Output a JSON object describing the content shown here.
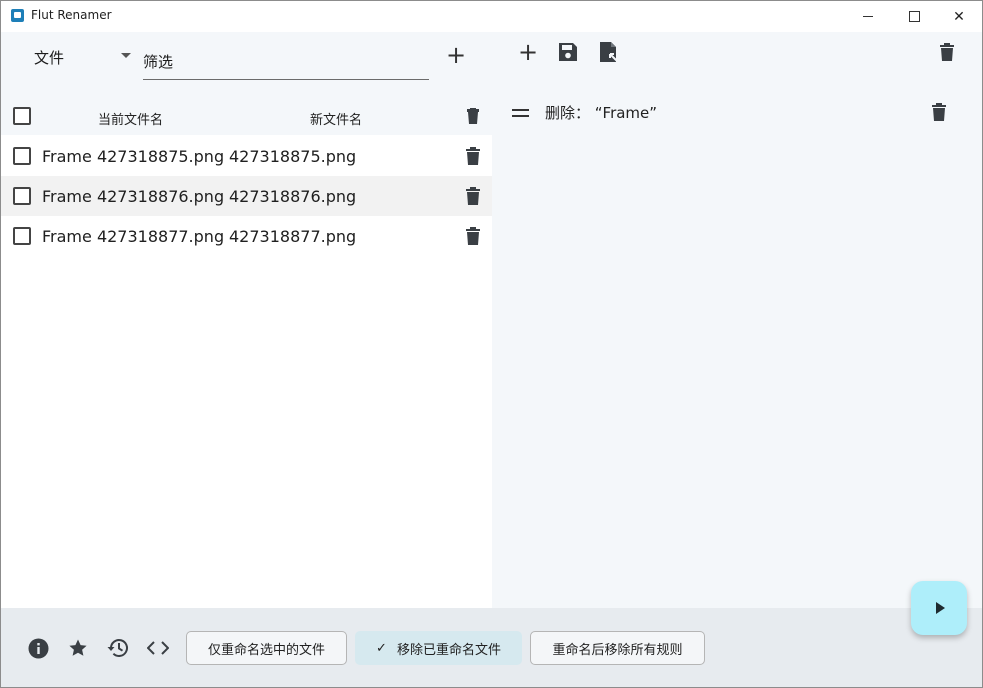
{
  "window": {
    "title": "Flut Renamer",
    "close_glyph": "✕"
  },
  "file_panel": {
    "type_select": {
      "value": "文件"
    },
    "filter": {
      "placeholder": "筛选",
      "value": ""
    },
    "add_label": "+",
    "columns": {
      "current": "当前文件名",
      "new": "新文件名"
    },
    "rows": [
      {
        "current": "Frame 427318875.png",
        "new": "427318875.png"
      },
      {
        "current": "Frame 427318876.png",
        "new": "427318876.png"
      },
      {
        "current": "Frame 427318877.png",
        "new": "427318877.png"
      }
    ]
  },
  "rule_panel": {
    "add_label": "+",
    "rules": [
      {
        "text": "删除：  “Frame”"
      }
    ]
  },
  "bottom_bar": {
    "buttons": {
      "rename_selected_only": "仅重命名选中的文件",
      "remove_renamed": "移除已重命名文件",
      "remove_rules_after": "重命名后移除所有规则"
    },
    "remove_renamed_checked": true,
    "check_glyph": "✓"
  },
  "icons": [
    "add-icon",
    "save-icon",
    "file-export-icon",
    "trash-icon",
    "drag-handle-icon",
    "info-icon",
    "star-icon",
    "history-icon",
    "code-icon",
    "play-icon"
  ]
}
